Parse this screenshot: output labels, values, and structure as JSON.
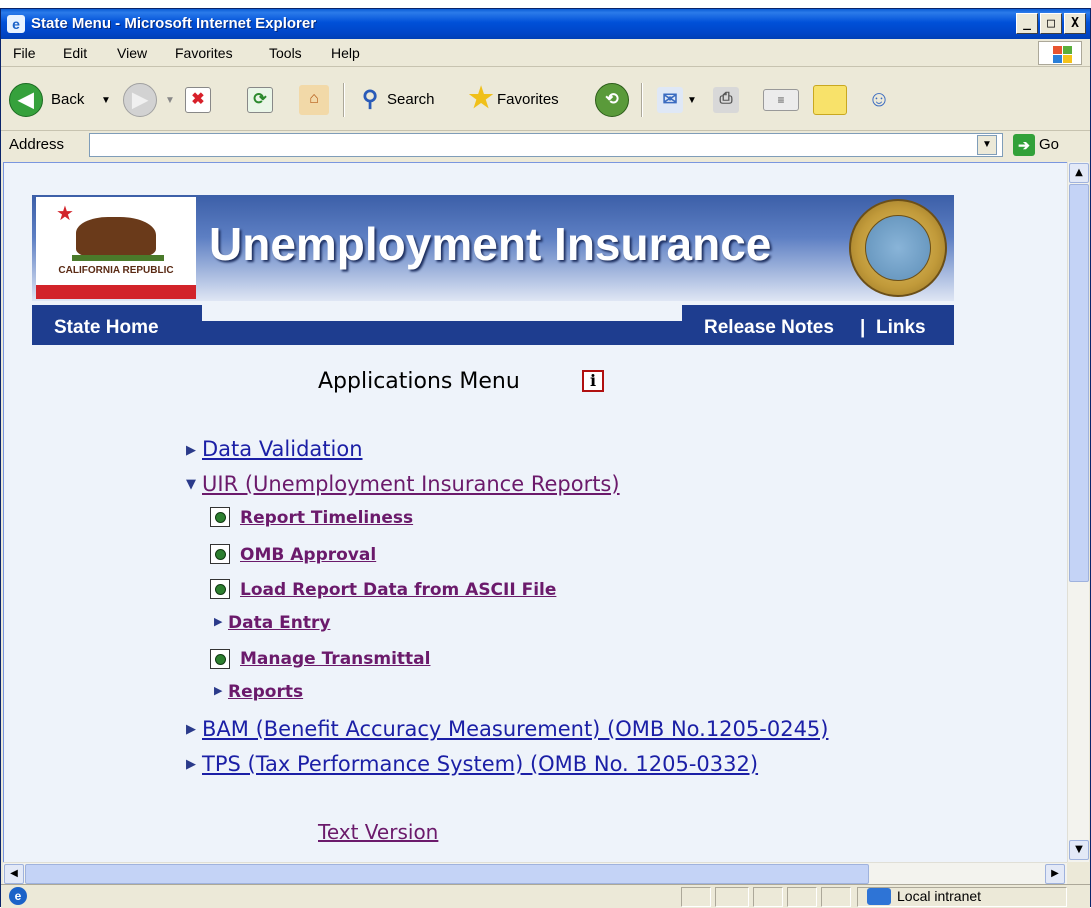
{
  "window": {
    "title": "State Menu - Microsoft Internet Explorer",
    "buttons": [
      "_",
      "□",
      "X"
    ]
  },
  "menubar": {
    "items": [
      "File",
      "Edit",
      "View",
      "Favorites",
      "Tools",
      "Help"
    ]
  },
  "toolbar": {
    "back_label": "Back",
    "search_label": "Search",
    "favorites_label": "Favorites"
  },
  "addressbar": {
    "label": "Address",
    "value": "",
    "go_label": "Go"
  },
  "statusbar": {
    "zone": "Local intranet"
  },
  "page": {
    "banner_title": "Unemployment Insurance",
    "flag_text": "CALIFORNIA REPUBLIC",
    "nav": {
      "home": "State Home",
      "release_notes": "Release Notes",
      "separator": "|",
      "links": "Links"
    },
    "apps_title": "Applications Menu",
    "info_icon": "i",
    "menu": {
      "data_validation": "Data Validation",
      "uir": "UIR (Unemployment Insurance Reports)",
      "uir_items": {
        "report_timeliness": "Report Timeliness",
        "omb_approval": "OMB Approval",
        "load_report": "Load Report Data from ASCII File",
        "data_entry": "Data Entry",
        "manage_transmittal": "Manage Transmittal",
        "reports": "Reports"
      },
      "bam": "BAM (Benefit Accuracy Measurement) (OMB No.1205-0245)",
      "tps": "TPS (Tax Performance System) (OMB No. 1205-0332)"
    },
    "text_version": "Text Version"
  },
  "colors": {
    "title_bar": "#0050d8",
    "nav_bar": "#1e3d8f",
    "link": "#1b1fa6",
    "visited_link": "#6b1a6b",
    "page_bg": "#eef3fa"
  }
}
